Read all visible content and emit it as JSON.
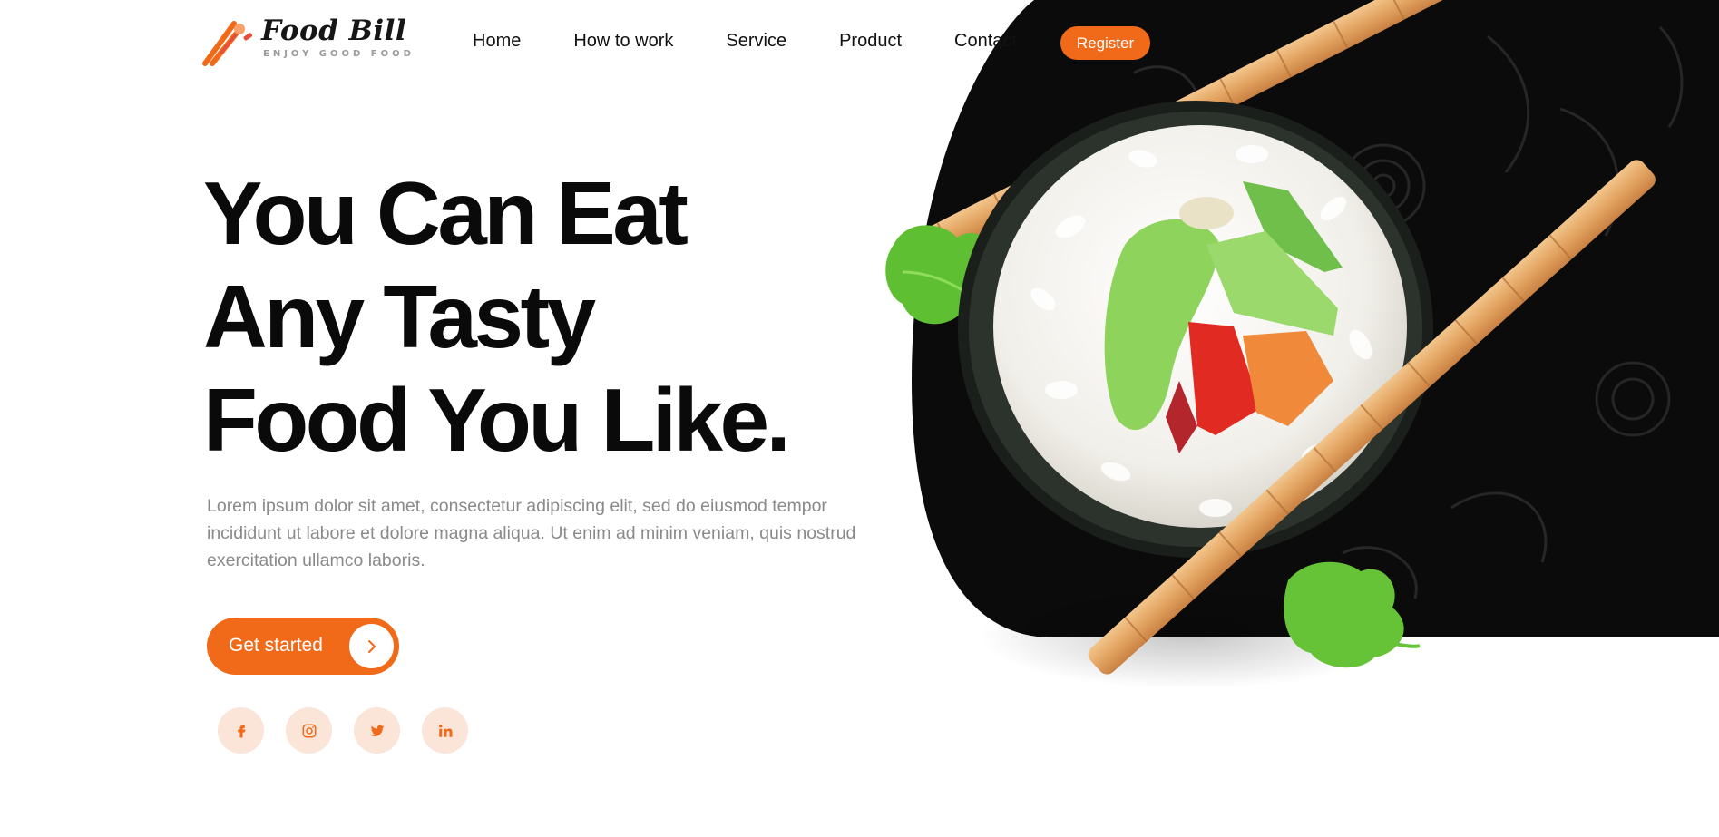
{
  "brand": {
    "name": "Food Bill",
    "tagline": "ENJOY GOOD FOOD",
    "logo_icon": "cutlery-logo-icon"
  },
  "nav": {
    "items": [
      {
        "label": "Home"
      },
      {
        "label": "How to work"
      },
      {
        "label": "Service"
      },
      {
        "label": "Product"
      },
      {
        "label": "Contact"
      }
    ],
    "register_label": "Register"
  },
  "hero": {
    "title_lines": [
      "You Can Eat",
      "Any Tasty",
      "Food You Like."
    ],
    "description": "Lorem ipsum dolor sit amet, consectetur adipiscing elit, sed do eiusmod tempor incididunt ut labore et dolore magna aliqua. Ut enim ad minim veniam, quis nostrud exercitation ullamco laboris.",
    "cta_label": "Get started",
    "cta_icon": "chevron-right-icon",
    "image": "sushi-roll-with-chopsticks"
  },
  "socials": [
    {
      "icon": "facebook-icon"
    },
    {
      "icon": "instagram-icon"
    },
    {
      "icon": "twitter-icon"
    },
    {
      "icon": "linkedin-icon"
    }
  ],
  "colors": {
    "accent": "#f16a1a",
    "social_bg": "#fbe4d8",
    "dark_panel": "#0b0b0b",
    "heading": "#0a0a0a",
    "body_text": "#8a8a8a"
  }
}
